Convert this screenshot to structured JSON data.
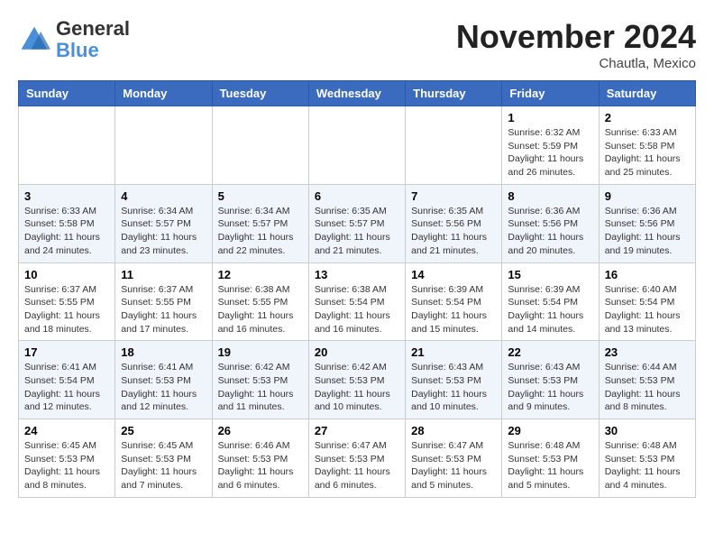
{
  "logo": {
    "general": "General",
    "blue": "Blue"
  },
  "header": {
    "month": "November 2024",
    "location": "Chautla, Mexico"
  },
  "weekdays": [
    "Sunday",
    "Monday",
    "Tuesday",
    "Wednesday",
    "Thursday",
    "Friday",
    "Saturday"
  ],
  "weeks": [
    [
      {
        "day": "",
        "info": ""
      },
      {
        "day": "",
        "info": ""
      },
      {
        "day": "",
        "info": ""
      },
      {
        "day": "",
        "info": ""
      },
      {
        "day": "",
        "info": ""
      },
      {
        "day": "1",
        "info": "Sunrise: 6:32 AM\nSunset: 5:59 PM\nDaylight: 11 hours\nand 26 minutes."
      },
      {
        "day": "2",
        "info": "Sunrise: 6:33 AM\nSunset: 5:58 PM\nDaylight: 11 hours\nand 25 minutes."
      }
    ],
    [
      {
        "day": "3",
        "info": "Sunrise: 6:33 AM\nSunset: 5:58 PM\nDaylight: 11 hours\nand 24 minutes."
      },
      {
        "day": "4",
        "info": "Sunrise: 6:34 AM\nSunset: 5:57 PM\nDaylight: 11 hours\nand 23 minutes."
      },
      {
        "day": "5",
        "info": "Sunrise: 6:34 AM\nSunset: 5:57 PM\nDaylight: 11 hours\nand 22 minutes."
      },
      {
        "day": "6",
        "info": "Sunrise: 6:35 AM\nSunset: 5:57 PM\nDaylight: 11 hours\nand 21 minutes."
      },
      {
        "day": "7",
        "info": "Sunrise: 6:35 AM\nSunset: 5:56 PM\nDaylight: 11 hours\nand 21 minutes."
      },
      {
        "day": "8",
        "info": "Sunrise: 6:36 AM\nSunset: 5:56 PM\nDaylight: 11 hours\nand 20 minutes."
      },
      {
        "day": "9",
        "info": "Sunrise: 6:36 AM\nSunset: 5:56 PM\nDaylight: 11 hours\nand 19 minutes."
      }
    ],
    [
      {
        "day": "10",
        "info": "Sunrise: 6:37 AM\nSunset: 5:55 PM\nDaylight: 11 hours\nand 18 minutes."
      },
      {
        "day": "11",
        "info": "Sunrise: 6:37 AM\nSunset: 5:55 PM\nDaylight: 11 hours\nand 17 minutes."
      },
      {
        "day": "12",
        "info": "Sunrise: 6:38 AM\nSunset: 5:55 PM\nDaylight: 11 hours\nand 16 minutes."
      },
      {
        "day": "13",
        "info": "Sunrise: 6:38 AM\nSunset: 5:54 PM\nDaylight: 11 hours\nand 16 minutes."
      },
      {
        "day": "14",
        "info": "Sunrise: 6:39 AM\nSunset: 5:54 PM\nDaylight: 11 hours\nand 15 minutes."
      },
      {
        "day": "15",
        "info": "Sunrise: 6:39 AM\nSunset: 5:54 PM\nDaylight: 11 hours\nand 14 minutes."
      },
      {
        "day": "16",
        "info": "Sunrise: 6:40 AM\nSunset: 5:54 PM\nDaylight: 11 hours\nand 13 minutes."
      }
    ],
    [
      {
        "day": "17",
        "info": "Sunrise: 6:41 AM\nSunset: 5:54 PM\nDaylight: 11 hours\nand 12 minutes."
      },
      {
        "day": "18",
        "info": "Sunrise: 6:41 AM\nSunset: 5:53 PM\nDaylight: 11 hours\nand 12 minutes."
      },
      {
        "day": "19",
        "info": "Sunrise: 6:42 AM\nSunset: 5:53 PM\nDaylight: 11 hours\nand 11 minutes."
      },
      {
        "day": "20",
        "info": "Sunrise: 6:42 AM\nSunset: 5:53 PM\nDaylight: 11 hours\nand 10 minutes."
      },
      {
        "day": "21",
        "info": "Sunrise: 6:43 AM\nSunset: 5:53 PM\nDaylight: 11 hours\nand 10 minutes."
      },
      {
        "day": "22",
        "info": "Sunrise: 6:43 AM\nSunset: 5:53 PM\nDaylight: 11 hours\nand 9 minutes."
      },
      {
        "day": "23",
        "info": "Sunrise: 6:44 AM\nSunset: 5:53 PM\nDaylight: 11 hours\nand 8 minutes."
      }
    ],
    [
      {
        "day": "24",
        "info": "Sunrise: 6:45 AM\nSunset: 5:53 PM\nDaylight: 11 hours\nand 8 minutes."
      },
      {
        "day": "25",
        "info": "Sunrise: 6:45 AM\nSunset: 5:53 PM\nDaylight: 11 hours\nand 7 minutes."
      },
      {
        "day": "26",
        "info": "Sunrise: 6:46 AM\nSunset: 5:53 PM\nDaylight: 11 hours\nand 6 minutes."
      },
      {
        "day": "27",
        "info": "Sunrise: 6:47 AM\nSunset: 5:53 PM\nDaylight: 11 hours\nand 6 minutes."
      },
      {
        "day": "28",
        "info": "Sunrise: 6:47 AM\nSunset: 5:53 PM\nDaylight: 11 hours\nand 5 minutes."
      },
      {
        "day": "29",
        "info": "Sunrise: 6:48 AM\nSunset: 5:53 PM\nDaylight: 11 hours\nand 5 minutes."
      },
      {
        "day": "30",
        "info": "Sunrise: 6:48 AM\nSunset: 5:53 PM\nDaylight: 11 hours\nand 4 minutes."
      }
    ]
  ]
}
